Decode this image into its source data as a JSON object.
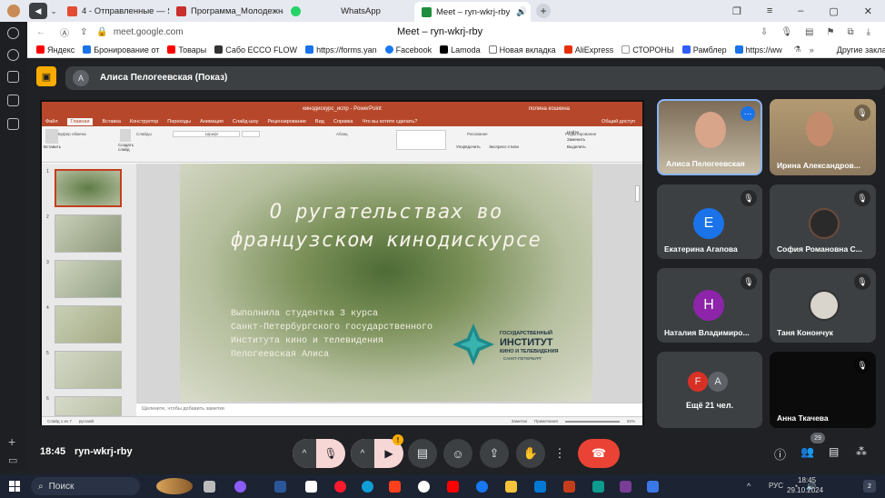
{
  "browser": {
    "tabs": [
      {
        "label": "4 - Отправленные — Янде",
        "color": "#e34b33"
      },
      {
        "label": "Программа_Молодежна",
        "color": "#c9302c"
      },
      {
        "label": "",
        "color": "#25d366"
      },
      {
        "label": "WhatsApp",
        "color": ""
      },
      {
        "label": "Meet – ryn-wkrj-rby",
        "color": "#1e8e3e",
        "active": true
      }
    ],
    "url": "meet.google.com",
    "page_title": "Meet – ryn-wkrj-rby",
    "bookmarks": [
      {
        "label": "Яндекс",
        "color": "#f00"
      },
      {
        "label": "Бронирование от",
        "color": "#1a73e8"
      },
      {
        "label": "Товары",
        "color": "#f00"
      },
      {
        "label": "Сабо ECCO FLOW",
        "color": "#333"
      },
      {
        "label": "https://forms.yan",
        "color": "#1a73e8"
      },
      {
        "label": "Facebook",
        "color": "#1877f2"
      },
      {
        "label": "Lamoda",
        "color": "#000"
      },
      {
        "label": "Новая вкладка",
        "color": "#777"
      },
      {
        "label": "AliExpress",
        "color": "#e62e04"
      },
      {
        "label": "СТОРОНЫ",
        "color": "#999"
      },
      {
        "label": "Рамблер",
        "color": "#315efb"
      },
      {
        "label": "https://ww",
        "color": "#1a73e8"
      }
    ],
    "other_bookmarks": "Другие закладки"
  },
  "meet": {
    "presenter_label": "Алиса Пелогеевская (Показ)",
    "presenter_initial": "А",
    "time": "18:45",
    "meeting_code": "ryn-wkrj-rby",
    "participant_count": "29",
    "participants": [
      {
        "name": "Алиса Пелогеевская",
        "type": "video"
      },
      {
        "name": "Ирина Александров...",
        "type": "video"
      },
      {
        "name": "Екатерина Агапова",
        "initial": "Е",
        "color": "#1a73e8"
      },
      {
        "name": "София Романовна С...",
        "type": "video"
      },
      {
        "name": "Наталия Владимиро...",
        "initial": "Н",
        "color": "#8e24aa"
      },
      {
        "name": "Таня Конончук",
        "type": "video"
      },
      {
        "name": "Ещё 21 чел.",
        "initials": [
          "F",
          "А"
        ]
      },
      {
        "name": "Анна Ткачева",
        "type": "video"
      }
    ]
  },
  "ppt": {
    "window_title": "кинодискурс_испр  -  PowerPoint",
    "user": "полина кошкина",
    "menu": [
      "Файл",
      "Главная",
      "Вставка",
      "Конструктор",
      "Переходы",
      "Анимация",
      "Слайд-шоу",
      "Рецензирование",
      "Вид",
      "Справка",
      "Что вы хотите сделать?"
    ],
    "share": "Общий доступ",
    "ribbon_groups": [
      "Буфер обмена",
      "Слайды",
      "Шрифт",
      "Абзац",
      "Рисование",
      "Редактирование"
    ],
    "ribbon_buttons": [
      "Вставить",
      "Создать слайд",
      "Упорядочить",
      "Экспресс-стили",
      "Найти",
      "Заменить",
      "Выделить"
    ],
    "slide_numbers": [
      "1",
      "2",
      "3",
      "4",
      "5",
      "6"
    ],
    "slide_title": "О ругательствах во французском кинодискурсе",
    "slide_subtitle": [
      "Выполнила студентка 3 курса",
      "Санкт-Петербургского государственного",
      "Института кино и телевидения",
      "Пелогеевская Алиса"
    ],
    "logo_lines": [
      "ГОСУДАРСТВЕННЫЙ",
      "ИНСТИТУТ",
      "КИНО И ТЕЛЕВИДЕНИЯ",
      "САНКТ-ПЕТЕРБУРГ"
    ],
    "notes_placeholder": "Щелкните, чтобы добавить заметки",
    "status_slide": "Слайд 1 из 7",
    "status_lang": "русский",
    "status_notes": "Заметки",
    "status_comments": "Примечания",
    "zoom": "82%"
  },
  "taskbar": {
    "search": "Поиск",
    "lang": "РУС",
    "time": "18:45",
    "date": "29.10.2024"
  }
}
